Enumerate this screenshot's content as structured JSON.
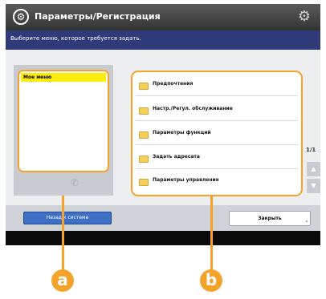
{
  "header": {
    "title": "Параметры/Регистрация",
    "subtitle": "Выберите меню, которое требуется задать.",
    "title_icon": "settings-circle-icon",
    "gear_icon": "gear-icon"
  },
  "left_list": {
    "selected_item": "Мое меню"
  },
  "right_list": {
    "items": [
      {
        "label": "Предпочтения",
        "icon": "folder-icon"
      },
      {
        "label": "Настр./Регул. обслуживание",
        "icon": "folder-icon"
      },
      {
        "label": "Параметры функций",
        "icon": "folder-icon"
      },
      {
        "label": "Задать адресата",
        "icon": "folder-icon"
      },
      {
        "label": "Параметры управления",
        "icon": "folder-icon"
      }
    ],
    "page": "1/1"
  },
  "footer": {
    "back_label": "Назад к системе",
    "close_label": "Закрыть"
  },
  "callouts": {
    "a": "a",
    "b": "b"
  },
  "colors": {
    "accent": "#f5a22a",
    "header_bg": "#2f3a78",
    "selected_bg": "#ffec0f",
    "button_blue": "#3f6fc4"
  }
}
